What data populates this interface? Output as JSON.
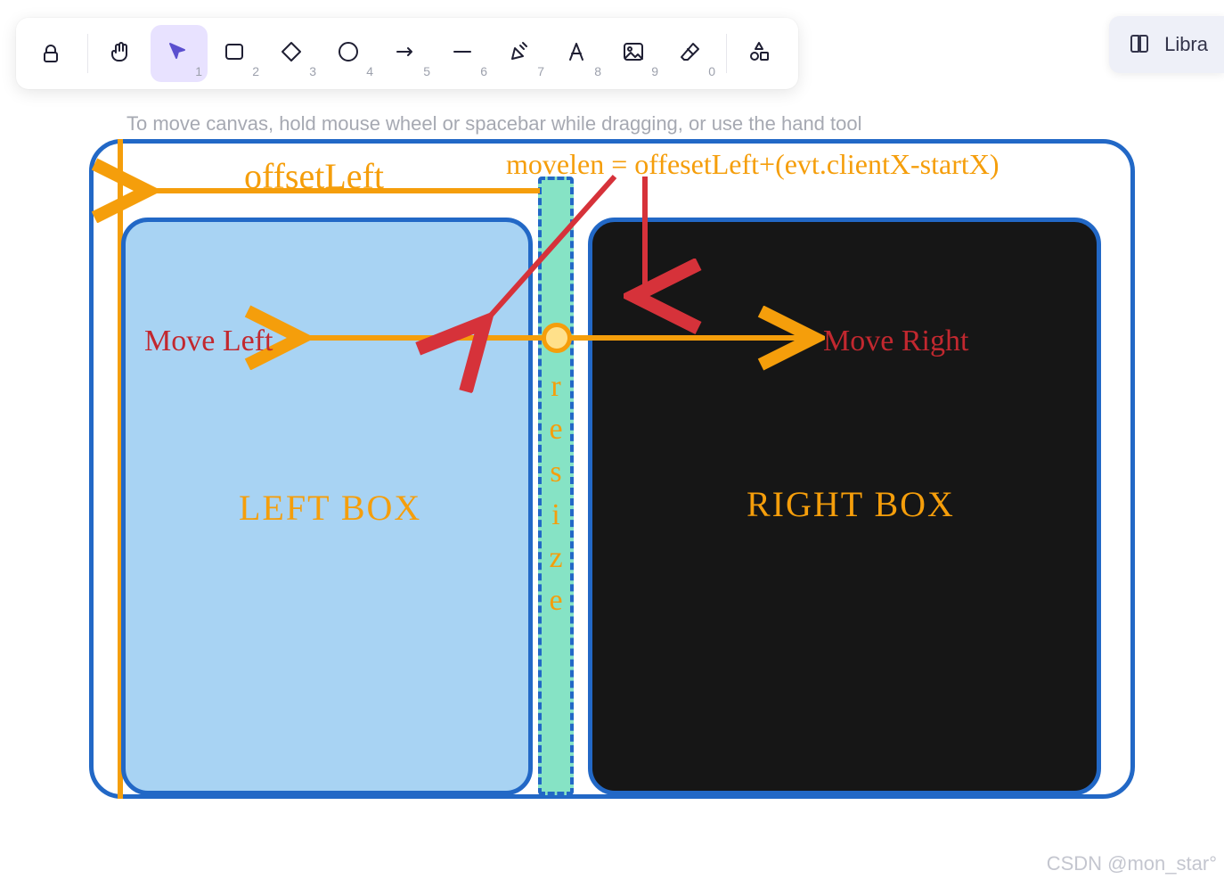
{
  "toolbar": {
    "tools": [
      {
        "name": "lock-icon",
        "hotkey": ""
      },
      {
        "name": "hand-icon",
        "hotkey": ""
      },
      {
        "name": "selection-icon",
        "hotkey": "1",
        "selected": true
      },
      {
        "name": "rectangle-icon",
        "hotkey": "2"
      },
      {
        "name": "diamond-icon",
        "hotkey": "3"
      },
      {
        "name": "ellipse-icon",
        "hotkey": "4"
      },
      {
        "name": "arrow-icon",
        "hotkey": "5"
      },
      {
        "name": "line-icon",
        "hotkey": "6"
      },
      {
        "name": "draw-icon",
        "hotkey": "7"
      },
      {
        "name": "text-icon",
        "hotkey": "8"
      },
      {
        "name": "image-icon",
        "hotkey": "9"
      },
      {
        "name": "eraser-icon",
        "hotkey": "0"
      },
      {
        "name": "shapes-icon",
        "hotkey": ""
      }
    ]
  },
  "library_button": {
    "label": "Libra"
  },
  "hint": "To move canvas, hold mouse wheel or spacebar while dragging, or use the hand tool",
  "diagram": {
    "offset_label": "offsetLeft",
    "formula": "movelen = offesetLeft+(evt.clientX-startX)",
    "move_left": "Move Left",
    "move_right": "Move Right",
    "left_box": "LEFT BOX",
    "right_box": "RIGHT BOX",
    "resize_chars": [
      "r",
      "e",
      "s",
      "i",
      "z",
      "e"
    ]
  },
  "watermark": "CSDN @mon_star°"
}
